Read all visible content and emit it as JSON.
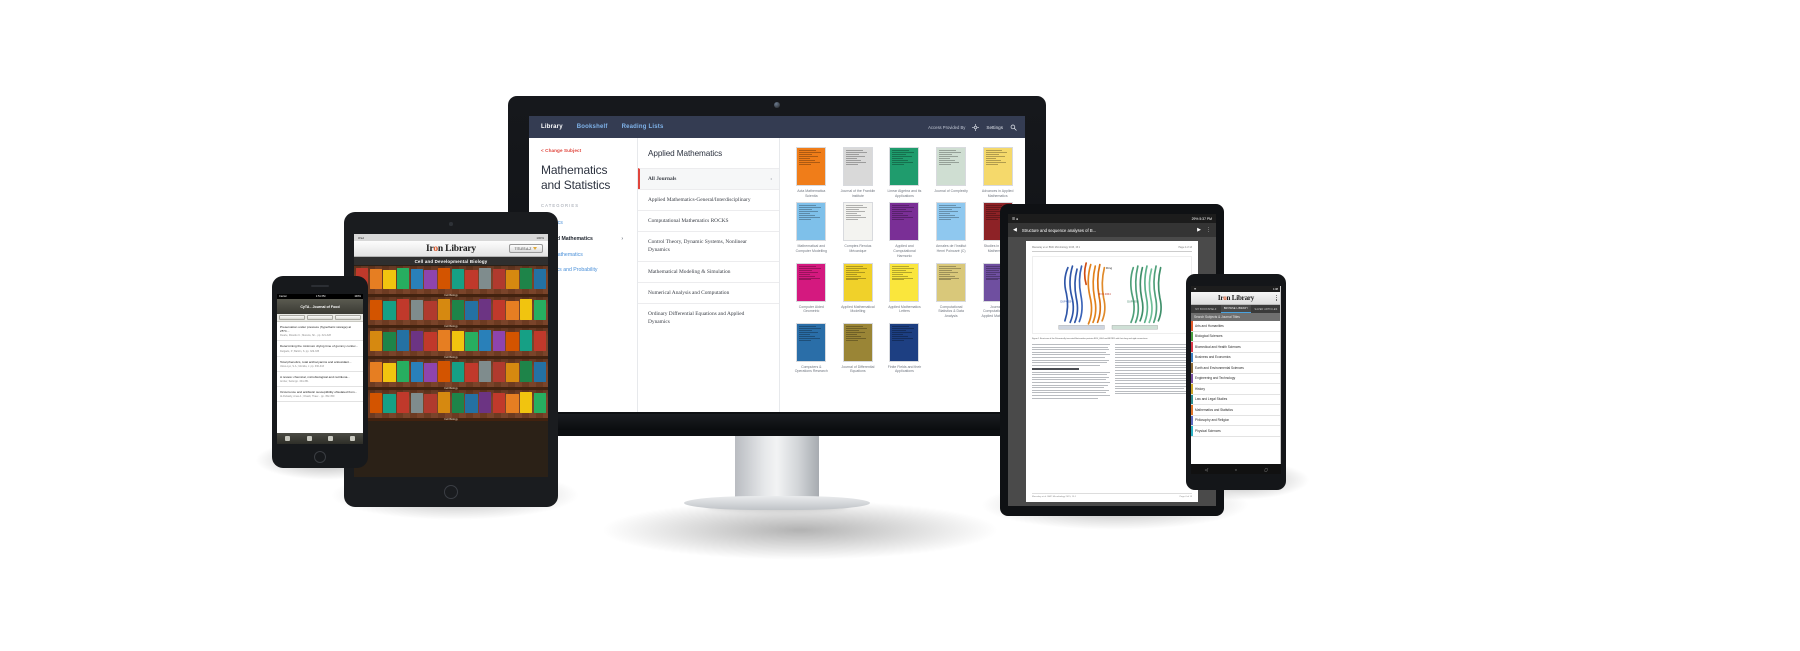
{
  "desktop": {
    "topnav": {
      "items": [
        {
          "label": "Library",
          "state": "active"
        },
        {
          "label": "Bookshelf",
          "state": "link"
        },
        {
          "label": "Reading Lists",
          "state": "link"
        }
      ],
      "access_label": "Access Provided By",
      "settings_label": "Settings",
      "gear_icon": "gear-icon",
      "search_icon": "search-icon"
    },
    "sidebar": {
      "change_subject": "< Change Subject",
      "title": "Mathematics and Statistics",
      "categories_header": "CATEGORIES",
      "items": [
        {
          "label": "All Topics",
          "selected": false,
          "chevron": false
        },
        {
          "label": "Applied Mathematics",
          "selected": true,
          "chevron": true
        },
        {
          "label": "Pure Mathematics",
          "selected": false,
          "chevron": false
        },
        {
          "label": "Statistics and Probability",
          "selected": false,
          "chevron": false
        }
      ]
    },
    "journals": {
      "heading": "Applied Mathematics",
      "items": [
        {
          "label": "All Journals",
          "active": true
        },
        {
          "label": "Applied Mathematics-General/Interdisciplinary",
          "active": false
        },
        {
          "label": "Computational Mathematics ROCKS",
          "active": false
        },
        {
          "label": "Control Theory, Dynamic Systems, Nonlinear Dynamics",
          "active": false
        },
        {
          "label": "Mathematical Modeling & Simulation",
          "active": false
        },
        {
          "label": "Numerical Analysis and Computation",
          "active": false
        },
        {
          "label": "Ordinary Differential Equations and Applied Dynamics",
          "active": false
        }
      ]
    },
    "covers": [
      {
        "title": "Acta Mathematica Scientia",
        "color": "#f07d19"
      },
      {
        "title": "Journal of the Franklin Institute",
        "color": "#d9d9d9"
      },
      {
        "title": "Linear Algebra and its Applications",
        "color": "#1f9c6d"
      },
      {
        "title": "Journal of Complexity",
        "color": "#cfded2"
      },
      {
        "title": "Advances in Applied Mathematics",
        "color": "#f5d96b"
      },
      {
        "title": "Mathematical and Computer Modelling",
        "color": "#7ec0ea"
      },
      {
        "title": "Comptes Rendus Mécanique",
        "color": "#f3f3f0"
      },
      {
        "title": "Applied and Computational Harmonic",
        "color": "#7a2f96"
      },
      {
        "title": "Annales de l'Institut Henri Poincaré (C)",
        "color": "#8fc8ef"
      },
      {
        "title": "Studies in Applied Mathematics",
        "color": "#8d2226"
      },
      {
        "title": "Computer Aided Geometric",
        "color": "#d4197f"
      },
      {
        "title": "Applied Mathematical Modelling",
        "color": "#f0d12a"
      },
      {
        "title": "Applied Mathematics Letters",
        "color": "#fae63c"
      },
      {
        "title": "Computational Statistics & Data Analysis",
        "color": "#d9c87a"
      },
      {
        "title": "Journal of Computational and Applied Mathematics",
        "color": "#6f4fa0"
      },
      {
        "title": "Computers & Operations Research",
        "color": "#2a6ea8"
      },
      {
        "title": "Journal of Differential Equations",
        "color": "#9a8536"
      },
      {
        "title": "Finite Fields and their Applications",
        "color": "#1d3f82"
      }
    ]
  },
  "ipad": {
    "status_left": "iPad",
    "status_right": "100%",
    "logo_pre": "Ir",
    "logo_accent": "o",
    "logo_post": "n Library",
    "dropdown_label": "TITLES A-Z",
    "category_bar": "Cell and Developmental Biology",
    "shelves": [
      {
        "label": "Cell Biology"
      },
      {
        "label": "Cell Biology"
      },
      {
        "label": "Cell Biology"
      },
      {
        "label": "Cell Biology"
      },
      {
        "label": "Cell Biology"
      }
    ]
  },
  "iphone": {
    "status_left": "Carrier",
    "status_center": "1:51 PM",
    "status_right": "100%",
    "nav_title": "CyTA - Journal of Food",
    "articles": [
      {
        "title": "Preservation under pressure (hyperbaric storage) at 25°C...",
        "meta": "Duarte, Ricardo C.; Moreira, Sil...   pp. 321-328"
      },
      {
        "title": "Determining the minimum drying time of gummy confec...",
        "meta": "Delgado, P.; Bañón, S.               pp. 329-335"
      },
      {
        "title": "Total phenolics, total anthocyanins and antioxidant...",
        "meta": "Ukwo-Lyo, S.A.; Montila, J.        pp. 336-343"
      },
      {
        "title": "A review: chemical, microbiological and nutritiona...",
        "meta": "Amber, Sefat                              pp. 344-351"
      },
      {
        "title": "Occurrence and antibiotic susceptibility ofisolated from...",
        "meta": "Al-Rubaidy, Anas A.; Obaidi, Thaer...  pp. 352-359"
      }
    ]
  },
  "tablet": {
    "status_time": "5:37 PM",
    "status_battery": "29%",
    "doc_title": "Structure and sequence analyses of B...",
    "page_header_left": "Macaulay et al. BMC Microbiology 2015, 15:1",
    "page_header_right": "Page 4 of 13",
    "figure_caption": "Figure 1 Structures of the N-terminally truncated Bacteroides proteins BVU_4064 and BF2811 with their long and rigid connections.",
    "section_a": "Strain BVU4 and two bacterial adhesion proteins",
    "section_b": "Strain BVU4 in other bacterial adhesin-like proteins",
    "page_footer_left": "Macaulay et al. BMC Microbiology 2015, 15:1",
    "page_footer_right": "Page 4 of 13"
  },
  "android": {
    "status_time": "1:08",
    "logo_pre": "Ir",
    "logo_accent": "o",
    "logo_post": "n Library",
    "tabs": [
      {
        "label": "MY BOOKSHELF",
        "on": false
      },
      {
        "label": "BROWSE LIBRARY",
        "on": true
      },
      {
        "label": "SAVED ARTICLES",
        "on": false
      }
    ],
    "search_placeholder": "Search Subjects & Journal Titles",
    "subjects": [
      {
        "label": "Arts and Humanities",
        "color": "#e05a2b"
      },
      {
        "label": "Biological Sciences",
        "color": "#4aa03f"
      },
      {
        "label": "Biomedical and Health Sciences",
        "color": "#d93a49"
      },
      {
        "label": "Business and Economics",
        "color": "#3d7fc1"
      },
      {
        "label": "Earth and Environmental Sciences",
        "color": "#8a6a3a"
      },
      {
        "label": "Engineering and Technology",
        "color": "#7a4fa0"
      },
      {
        "label": "History",
        "color": "#c9a227"
      },
      {
        "label": "Law and Legal Studies",
        "color": "#2f8f8f"
      },
      {
        "label": "Mathematics and Statistics",
        "color": "#e0762b"
      },
      {
        "label": "Philosophy and Religion",
        "color": "#5c6bc0"
      },
      {
        "label": "Physical Sciences",
        "color": "#2bb0c4"
      }
    ],
    "nav_back": "back-icon",
    "nav_home": "home-icon",
    "nav_recents": "recents-icon"
  }
}
